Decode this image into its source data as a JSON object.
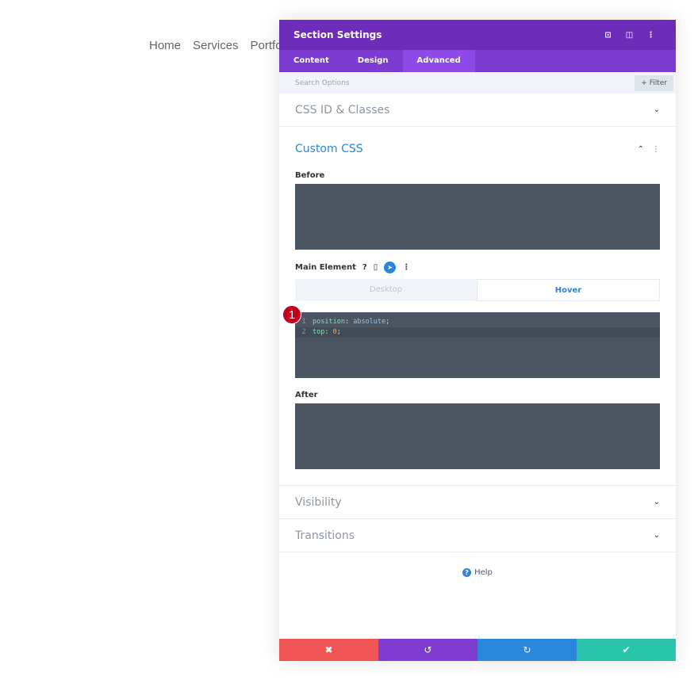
{
  "site_nav": [
    "Home",
    "Services",
    "Portfolio"
  ],
  "panel": {
    "title": "Section Settings",
    "icons": [
      "screenshot-icon",
      "split-view-icon",
      "more-icon"
    ],
    "tabs": [
      "Content",
      "Design",
      "Advanced"
    ],
    "active_tab": "Advanced",
    "search_placeholder": "Search Options",
    "filter_label": "+ Filter",
    "sections": {
      "css_id": "CSS ID & Classes",
      "custom_css": "Custom CSS",
      "visibility": "Visibility",
      "transitions": "Transitions"
    },
    "before_label": "Before",
    "main_element_label": "Main Element",
    "after_label": "After",
    "modes": {
      "desktop": "Desktop",
      "hover": "Hover"
    },
    "code": {
      "line1": {
        "n": "1",
        "prop": "position",
        "val": "absolute"
      },
      "line2": {
        "n": "2",
        "prop": "top",
        "val": "0"
      }
    },
    "badge": "1",
    "help_label": "Help"
  },
  "colors": {
    "header": "#6c2eb9",
    "tabs": "#7b3bd0",
    "accent": "#2b87da",
    "cancel": "#ef5555",
    "undo": "#7e3bd0",
    "redo": "#2b87da",
    "save": "#29c4a9"
  }
}
